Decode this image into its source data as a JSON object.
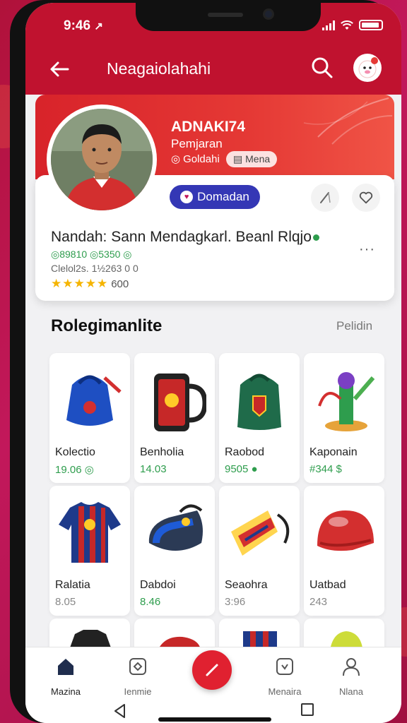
{
  "status_bar": {
    "time": "9:46",
    "time_arrow": "↗"
  },
  "header": {
    "title": "Neagaiolahahi"
  },
  "profile": {
    "name": "ADNAKI74",
    "role": "Pemjaran",
    "tag_1": "Goldahi",
    "tag_2": "Mena",
    "follow_label": "Domadan",
    "description": "Nandah: Sann Mendagkarl. Beanl Rlqjo",
    "stats": "◎89810 ◎5350 ◎",
    "subinfo": "Clelol2s. 1½263 0 0",
    "stars": "★★★★★",
    "rating_count": "600",
    "more_icon": "more-dots-icon"
  },
  "section": {
    "title": "Rolegimanlite",
    "link": "Pelidin"
  },
  "products": [
    {
      "name": "Kolectio",
      "price": "19.06 ◎",
      "price_color": "green",
      "icon": "backpack-blue-icon"
    },
    {
      "name": "Benholia",
      "price": "14.03",
      "price_color": "green",
      "icon": "mug-icon"
    },
    {
      "name": "Raobod",
      "price": "9505 ●",
      "price_color": "green",
      "icon": "backpack-green-icon"
    },
    {
      "name": "Kaponain",
      "price": "#344 $",
      "price_color": "green",
      "icon": "toy-icon"
    },
    {
      "name": "Ralatia",
      "price": "8.05",
      "price_color": "grey",
      "icon": "jersey-icon"
    },
    {
      "name": "Dabdoi",
      "price": "8.46",
      "price_color": "green",
      "icon": "bag-icon"
    },
    {
      "name": "Seaohra",
      "price": "3:96",
      "price_color": "grey",
      "icon": "scarf-icon"
    },
    {
      "name": "Uatbad",
      "price": "243",
      "price_color": "grey",
      "icon": "helmet-icon"
    }
  ],
  "bottom_nav": {
    "items": [
      {
        "label": "Mazina",
        "icon": "home-icon"
      },
      {
        "label": "Ienmie",
        "icon": "category-icon"
      },
      {
        "label": "Menaira",
        "icon": "message-icon"
      },
      {
        "label": "Nlana",
        "icon": "profile-icon"
      }
    ],
    "fab_icon": "edit-icon"
  },
  "colors": {
    "brand_red": "#c0122f",
    "accent_blue": "#3437b5",
    "price_green": "#2e9d4d",
    "star": "#f5b400"
  }
}
